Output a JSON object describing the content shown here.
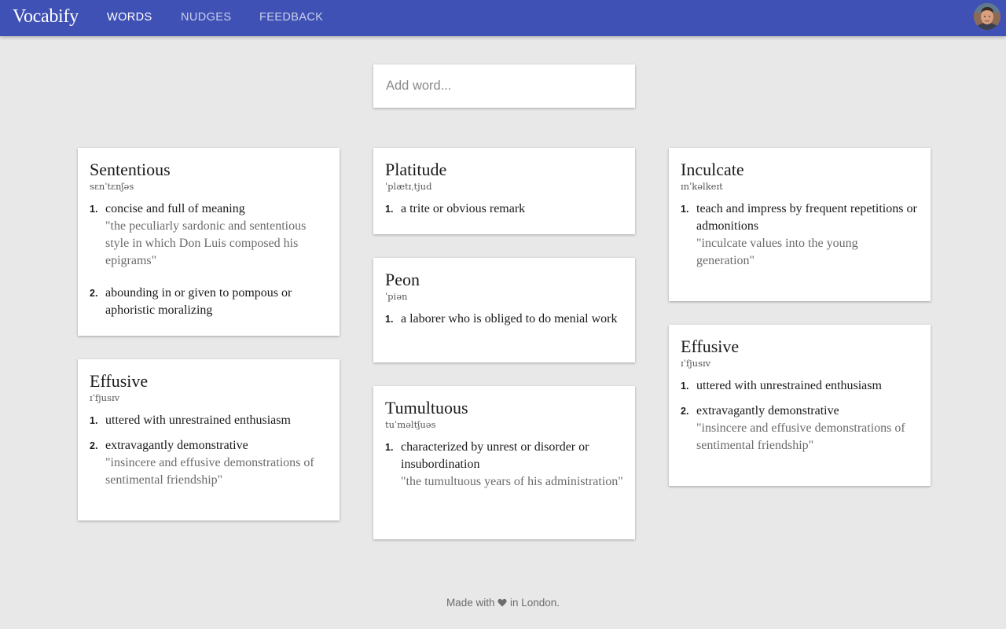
{
  "app": {
    "title": "Vocabify"
  },
  "nav": [
    {
      "label": "WORDS",
      "active": true
    },
    {
      "label": "NUDGES",
      "active": false
    },
    {
      "label": "FEEDBACK",
      "active": false
    }
  ],
  "search": {
    "placeholder": "Add word..."
  },
  "cards": [
    {
      "word": "Sententious",
      "pronunciation": "sɛnˈtɛnʃəs",
      "definitions": [
        {
          "text": "concise and full of meaning",
          "example": "\"the peculiarly sardonic and sententious style in which Don Luis composed his epigrams\""
        },
        {
          "text": "abounding in or given to pompous or aphoristic moralizing",
          "example": ""
        }
      ]
    },
    {
      "word": "Effusive",
      "pronunciation": "ɪˈfjusɪv",
      "definitions": [
        {
          "text": "uttered with unrestrained enthusiasm",
          "example": ""
        },
        {
          "text": "extravagantly demonstrative",
          "example": "\"insincere and effusive demonstrations of sentimental friendship\""
        }
      ]
    },
    {
      "word": "Platitude",
      "pronunciation": "ˈplætɪˌtjud",
      "definitions": [
        {
          "text": "a trite or obvious remark",
          "example": ""
        }
      ]
    },
    {
      "word": "Peon",
      "pronunciation": "ˈpiən",
      "definitions": [
        {
          "text": "a laborer who is obliged to do menial work",
          "example": ""
        }
      ]
    },
    {
      "word": "Tumultuous",
      "pronunciation": "tuˈməltʃuəs",
      "definitions": [
        {
          "text": "characterized by unrest or disorder or insubordination",
          "example": "\"the tumultuous years of his administration\""
        }
      ]
    },
    {
      "word": "Inculcate",
      "pronunciation": "ɪnˈkəlkeɪt",
      "definitions": [
        {
          "text": "teach and impress by frequent repetitions or admonitions",
          "example": "\"inculcate values into the young generation\""
        }
      ]
    },
    {
      "word": "Effusive",
      "pronunciation": "ɪˈfjusɪv",
      "definitions": [
        {
          "text": "uttered with unrestrained enthusiasm",
          "example": ""
        },
        {
          "text": "extravagantly demonstrative",
          "example": "\"insincere and effusive demonstrations of sentimental friendship\""
        }
      ]
    }
  ],
  "footer": {
    "before": "Made with",
    "after": "in London."
  },
  "icons": {
    "heart": "heart-icon",
    "avatar": "user-avatar"
  },
  "colors": {
    "appbar": "#3f51b5",
    "background": "#e8e8e8",
    "card": "#ffffff"
  }
}
